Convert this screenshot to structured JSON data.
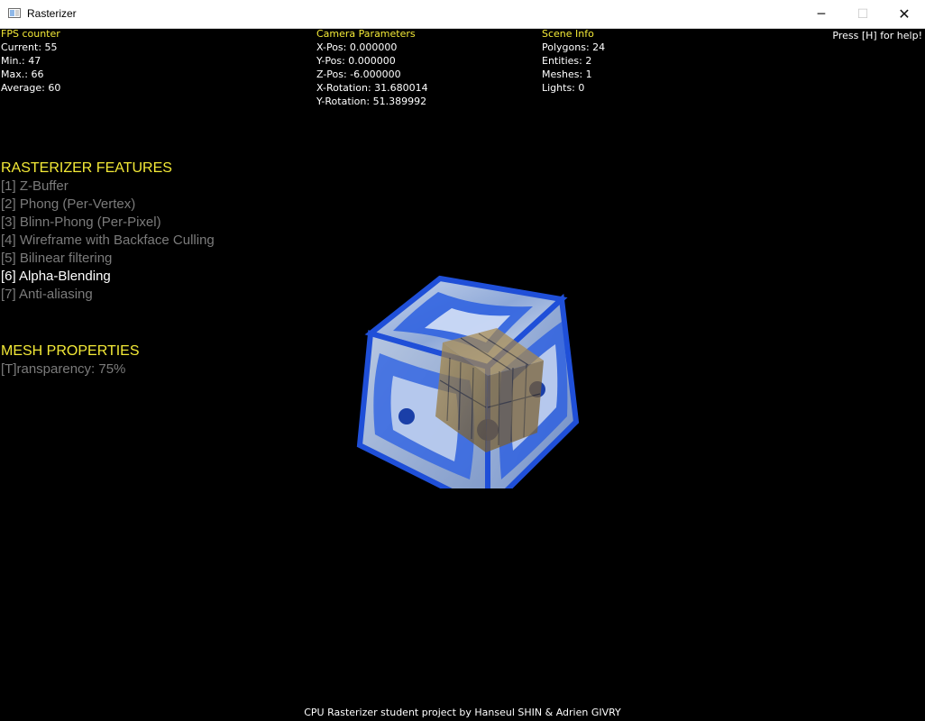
{
  "window": {
    "title": "Rasterizer",
    "controls": {
      "minimize": "─",
      "maximize": "☐",
      "close": "✕"
    }
  },
  "fps": {
    "heading": "FPS counter",
    "current": "Current: 55",
    "min": "Min.: 47",
    "max": "Max.: 66",
    "average": "Average: 60"
  },
  "camera": {
    "heading": "Camera Parameters",
    "x_pos": "X-Pos: 0.000000",
    "y_pos": "Y-Pos: 0.000000",
    "z_pos": "Z-Pos: -6.000000",
    "x_rot": "X-Rotation: 31.680014",
    "y_rot": "Y-Rotation: 51.389992"
  },
  "scene": {
    "heading": "Scene Info",
    "polygons": "Polygons: 24",
    "entities": "Entities: 2",
    "meshes": "Meshes: 1",
    "lights": "Lights: 0"
  },
  "help": "Press [H] for help!",
  "features": {
    "heading": "RASTERIZER FEATURES",
    "items": [
      {
        "label": "[1] Z-Buffer",
        "active": false
      },
      {
        "label": "[2] Phong (Per-Vertex)",
        "active": false
      },
      {
        "label": "[3] Blinn-Phong (Per-Pixel)",
        "active": false
      },
      {
        "label": "[4] Wireframe with Backface Culling",
        "active": false
      },
      {
        "label": "[5] Bilinear filtering",
        "active": false
      },
      {
        "label": "[6] Alpha-Blending",
        "active": true
      },
      {
        "label": "[7] Anti-aliasing",
        "active": false
      }
    ]
  },
  "mesh": {
    "heading": "MESH PROPERTIES",
    "transparency": "[T]ransparency: 75%"
  },
  "footer": "CPU Rasterizer student project by Hanseul SHIN & Adrien GIVRY",
  "colors": {
    "heading": "#f4ea37",
    "inactive": "#7b7b7b",
    "active": "#ffffff",
    "glass_blue": "#1f4fd8",
    "inner_cube": "#8a6a2a"
  }
}
